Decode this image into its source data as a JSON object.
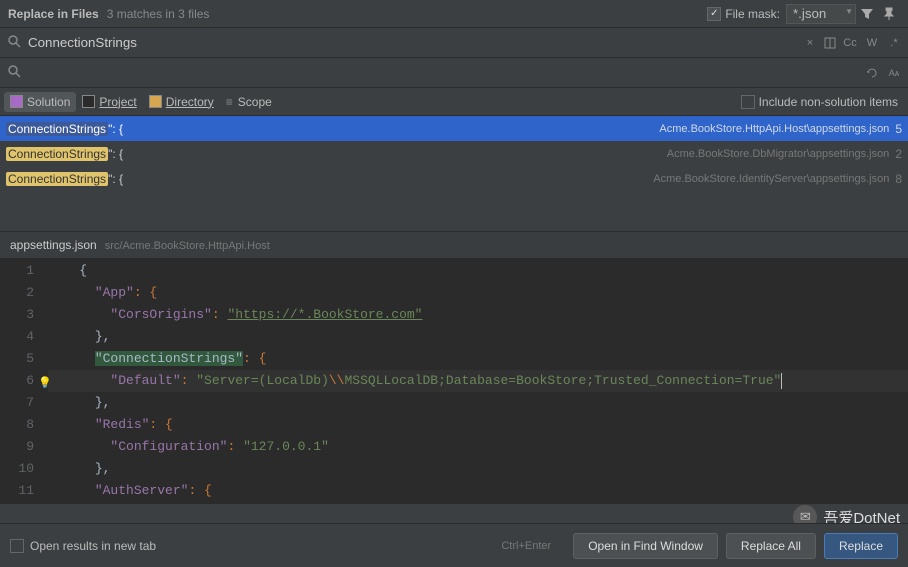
{
  "header": {
    "title": "Replace in Files",
    "subtitle": "3 matches in 3 files",
    "file_mask_label": "File mask:",
    "file_mask_value": "*.json"
  },
  "search": {
    "value": "ConnectionStrings",
    "cc": "Cc",
    "w": "W",
    "star": ".*"
  },
  "replace": {
    "value": ""
  },
  "scope": {
    "solution": "Solution",
    "project": "Project",
    "directory": "Directory",
    "scope": "Scope",
    "include_non_solution": "Include non-solution items"
  },
  "results": [
    {
      "match": "ConnectionStrings",
      "suffix": "\": {",
      "path": "Acme.BookStore.HttpApi.Host\\appsettings.json",
      "count": "5",
      "selected": true
    },
    {
      "match": "ConnectionStrings",
      "suffix": "\": {",
      "path": "Acme.BookStore.DbMigrator\\appsettings.json",
      "count": "2",
      "selected": false
    },
    {
      "match": "ConnectionStrings",
      "suffix": "\": {",
      "path": "Acme.BookStore.IdentityServer\\appsettings.json",
      "count": "8",
      "selected": false
    }
  ],
  "editor": {
    "filename": "appsettings.json",
    "path": "src/Acme.BookStore.HttpApi.Host",
    "lines": {
      "l1_brace": "{",
      "l2_app": "\"App\"",
      "l2_colon": ": {",
      "l3_cors": "\"CorsOrigins\"",
      "l3_colon": ": ",
      "l3_url": "\"https://*.BookStore.com\"",
      "l4_brace": "},",
      "l5_conn": "\"ConnectionStrings\"",
      "l5_colon": ": {",
      "l6_default": "\"Default\"",
      "l6_colon": ": ",
      "l6_val_1": "\"Server=(LocalDb)",
      "l6_esc": "\\\\",
      "l6_val_2": "MSSQLLocalDB;Database=BookStore;Trusted_Connection=True\"",
      "l7_brace": "},",
      "l8_redis": "\"Redis\"",
      "l8_colon": ": {",
      "l9_config": "\"Configuration\"",
      "l9_colon": ": ",
      "l9_val": "\"127.0.0.1\"",
      "l10_brace": "},",
      "l11_auth": "\"AuthServer\"",
      "l11_colon": ": {"
    }
  },
  "footer": {
    "open_new_tab": "Open results in new tab",
    "hint": "Ctrl+Enter",
    "open_in_window": "Open in Find Window",
    "replace_all": "Replace All",
    "replace": "Replace"
  },
  "watermark": "吾爱DotNet"
}
